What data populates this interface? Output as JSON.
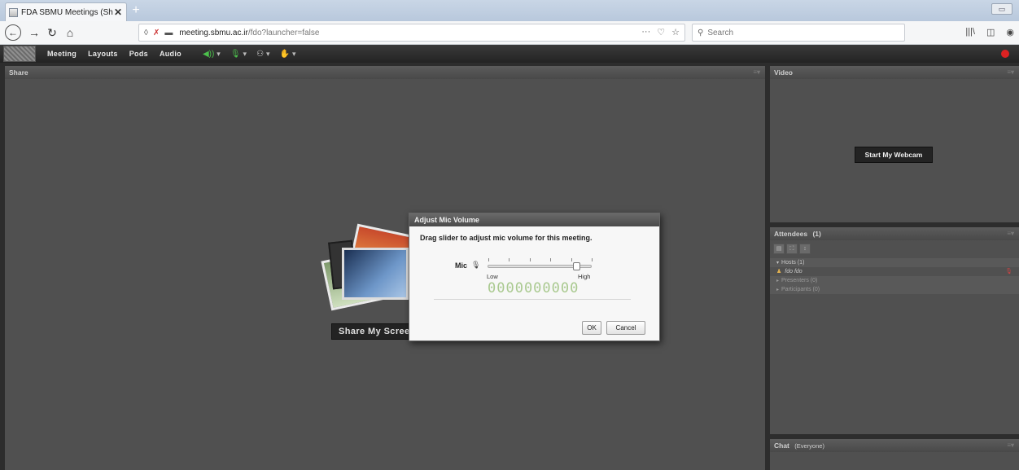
{
  "browser": {
    "tab_title": "FDA SBMU Meetings (Sharing)",
    "tab_close": "✕",
    "new_tab": "+",
    "url_host": "meeting.sbmu.ac.ir",
    "url_path": "/fdo?launcher=false",
    "url_actions": "···",
    "search_placeholder": "Search"
  },
  "app": {
    "menus": [
      "Meeting",
      "Layouts",
      "Pods",
      "Audio"
    ]
  },
  "pods": {
    "share": {
      "title": "Share",
      "button": "Share My Screen"
    },
    "video": {
      "title": "Video",
      "button": "Start My Webcam"
    },
    "attendees": {
      "title": "Attendees",
      "count": "(1)",
      "hosts": "Hosts (1)",
      "host_name": "fdo fdo",
      "presenters": "Presenters (0)",
      "participants": "Participants (0)"
    },
    "chat": {
      "title": "Chat",
      "scope": "(Everyone)"
    }
  },
  "dialog": {
    "title": "Adjust Mic Volume",
    "instruction": "Drag slider to adjust mic volume for this meeting.",
    "mic_label": "Mic",
    "low_label": "Low",
    "high_label": "High",
    "level_display": "0000000000",
    "slider_value": 0.87,
    "ok_label": "OK",
    "cancel_label": "Cancel"
  },
  "colors": {
    "recording": "#dd2222",
    "level_digits": "#a9c98f",
    "audio_active": "#4cc04c"
  }
}
